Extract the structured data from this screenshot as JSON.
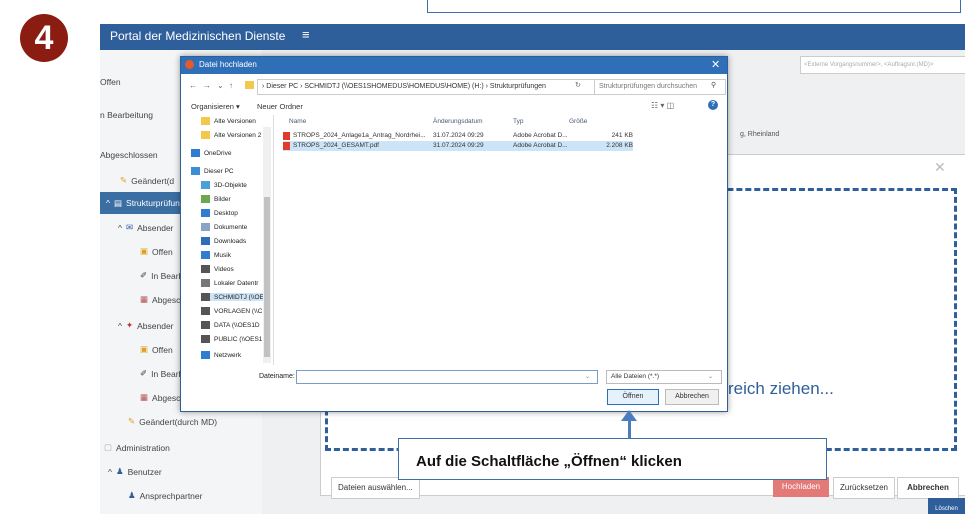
{
  "step_number": "4",
  "portal": {
    "title": "Portal der Medizinischen Dienste",
    "menu_icon": "hamburger-icon",
    "ext_placeholder": "<Externe Vorgangsnummer>, <Auftragsnr.(MD)>",
    "location_text": "g, Rheinland"
  },
  "sidebar": {
    "items": [
      {
        "label": "Offen"
      },
      {
        "label": "n Bearbeitung"
      },
      {
        "label": "Abgeschlossen"
      },
      {
        "label": "Geändert(d"
      },
      {
        "label": "Strukturprüfun"
      },
      {
        "label": "Absender"
      },
      {
        "label": "Offen"
      },
      {
        "label": "In Bearb"
      },
      {
        "label": "Abgeschl"
      },
      {
        "label": "Absender"
      },
      {
        "label": "Offen"
      },
      {
        "label": "In Bearb"
      },
      {
        "label": "Abgesch"
      },
      {
        "label": "Geändert(durch MD)"
      },
      {
        "label": "Administration"
      },
      {
        "label": "Benutzer"
      },
      {
        "label": "Ansprechpartner"
      }
    ]
  },
  "upload_modal": {
    "drop_text": "reich ziehen...",
    "select_button": "Dateien auswählen...",
    "upload_button": "Hochladen",
    "reset_button": "Zurücksetzen",
    "cancel_button": "Abbrechen",
    "delete_button": "Löschen"
  },
  "dialog": {
    "title": "Datei hochladen",
    "address": "›  Dieser PC  ›  SCHMIDTJ (\\\\OES1SHOMEDUS\\HOMEDUS\\HOME) (H:)  ›  Strukturprüfungen",
    "search_placeholder": "Strukturprüfungen durchsuchen",
    "organize": "Organisieren ▾",
    "new_folder": "Neuer Ordner",
    "nav_items": [
      {
        "label": "Alte Versionen",
        "icon": "folder"
      },
      {
        "label": "Alte Versionen 2",
        "icon": "folder"
      },
      {
        "label": "OneDrive",
        "icon": "cloud"
      },
      {
        "label": "Dieser PC",
        "icon": "pc"
      },
      {
        "label": "3D-Objekte",
        "icon": "3d"
      },
      {
        "label": "Bilder",
        "icon": "images"
      },
      {
        "label": "Desktop",
        "icon": "desktop"
      },
      {
        "label": "Dokumente",
        "icon": "documents"
      },
      {
        "label": "Downloads",
        "icon": "downloads"
      },
      {
        "label": "Musik",
        "icon": "music"
      },
      {
        "label": "Videos",
        "icon": "videos"
      },
      {
        "label": "Lokaler Datentr",
        "icon": "drive"
      },
      {
        "label": "SCHMIDTJ (\\\\OE",
        "icon": "network-drive"
      },
      {
        "label": "VORLAGEN (\\\\C",
        "icon": "network-drive"
      },
      {
        "label": "DATA (\\\\OES1D",
        "icon": "network-drive"
      },
      {
        "label": "PUBLIC (\\\\OES1",
        "icon": "network-drive"
      },
      {
        "label": "Netzwerk",
        "icon": "network"
      }
    ],
    "columns": [
      "Name",
      "Änderungsdatum",
      "Typ",
      "Größe"
    ],
    "files": [
      {
        "name": "STROPS_2024_Anlage1a_Antrag_Nordrhei...",
        "date": "31.07.2024 09:29",
        "type": "Adobe Acrobat D...",
        "size": "241 KB"
      },
      {
        "name": "STROPS_2024_GESAMT.pdf",
        "date": "31.07.2024 09:29",
        "type": "Adobe Acrobat D...",
        "size": "2.208 KB"
      }
    ],
    "filename_label": "Dateiname:",
    "filename_value": "",
    "filter_value": "Alle Dateien (*.*)",
    "open_button": "Öffnen",
    "cancel_button": "Abbrechen"
  },
  "callout": {
    "text": "Auf die Schaltfläche „Öffnen“ klicken"
  },
  "colors": {
    "brand_blue": "#2f5f9b",
    "badge_red": "#8b1c12",
    "upload_red": "#e37a77"
  }
}
